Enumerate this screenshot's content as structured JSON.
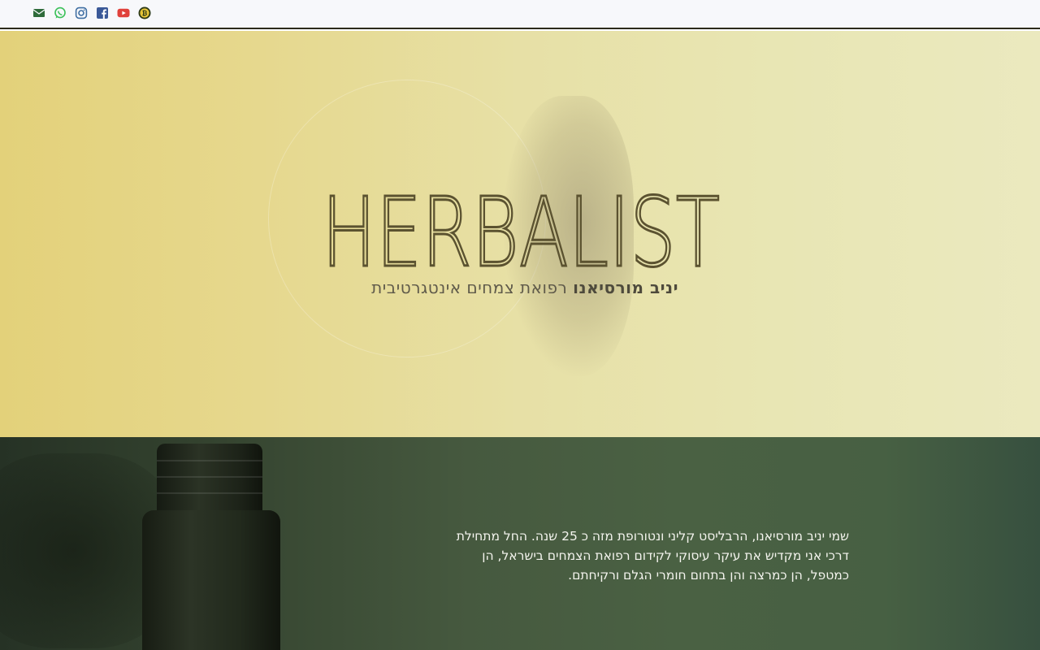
{
  "social": [
    {
      "name": "email-icon",
      "color": "#2e6b3a"
    },
    {
      "name": "whatsapp-icon",
      "color": "#3cc15a"
    },
    {
      "name": "instagram-icon",
      "color": "#3f6ea2"
    },
    {
      "name": "facebook-icon",
      "color": "#3b5998"
    },
    {
      "name": "youtube-icon",
      "color": "#e0413b"
    },
    {
      "name": "bitcoin-icon",
      "color": "#2d3a17"
    }
  ],
  "hero": {
    "brand": "HERBALIST",
    "tagline_name": "יניב מורסיאנו",
    "tagline_rest": " רפואת צמחים אינטגרטיבית"
  },
  "about": {
    "line1": "שמי יניב מורסיאנו, הרבליסט קליני ונטורופת מזה כ 25 שנה. החל מתחילת",
    "line2": "דרכי אני מקדיש את עיקר עיסוקי לקידום רפואת הצמחים בישראל, הן",
    "line3": "כמטפל, הן כמרצה והן בתחום חומרי הגלם ורקיחתם."
  },
  "colors": {
    "brand_text": "#5b5230",
    "hero_left": "#e3d17a",
    "hero_right": "#ebe9bf",
    "about_bg": "#46593f"
  }
}
